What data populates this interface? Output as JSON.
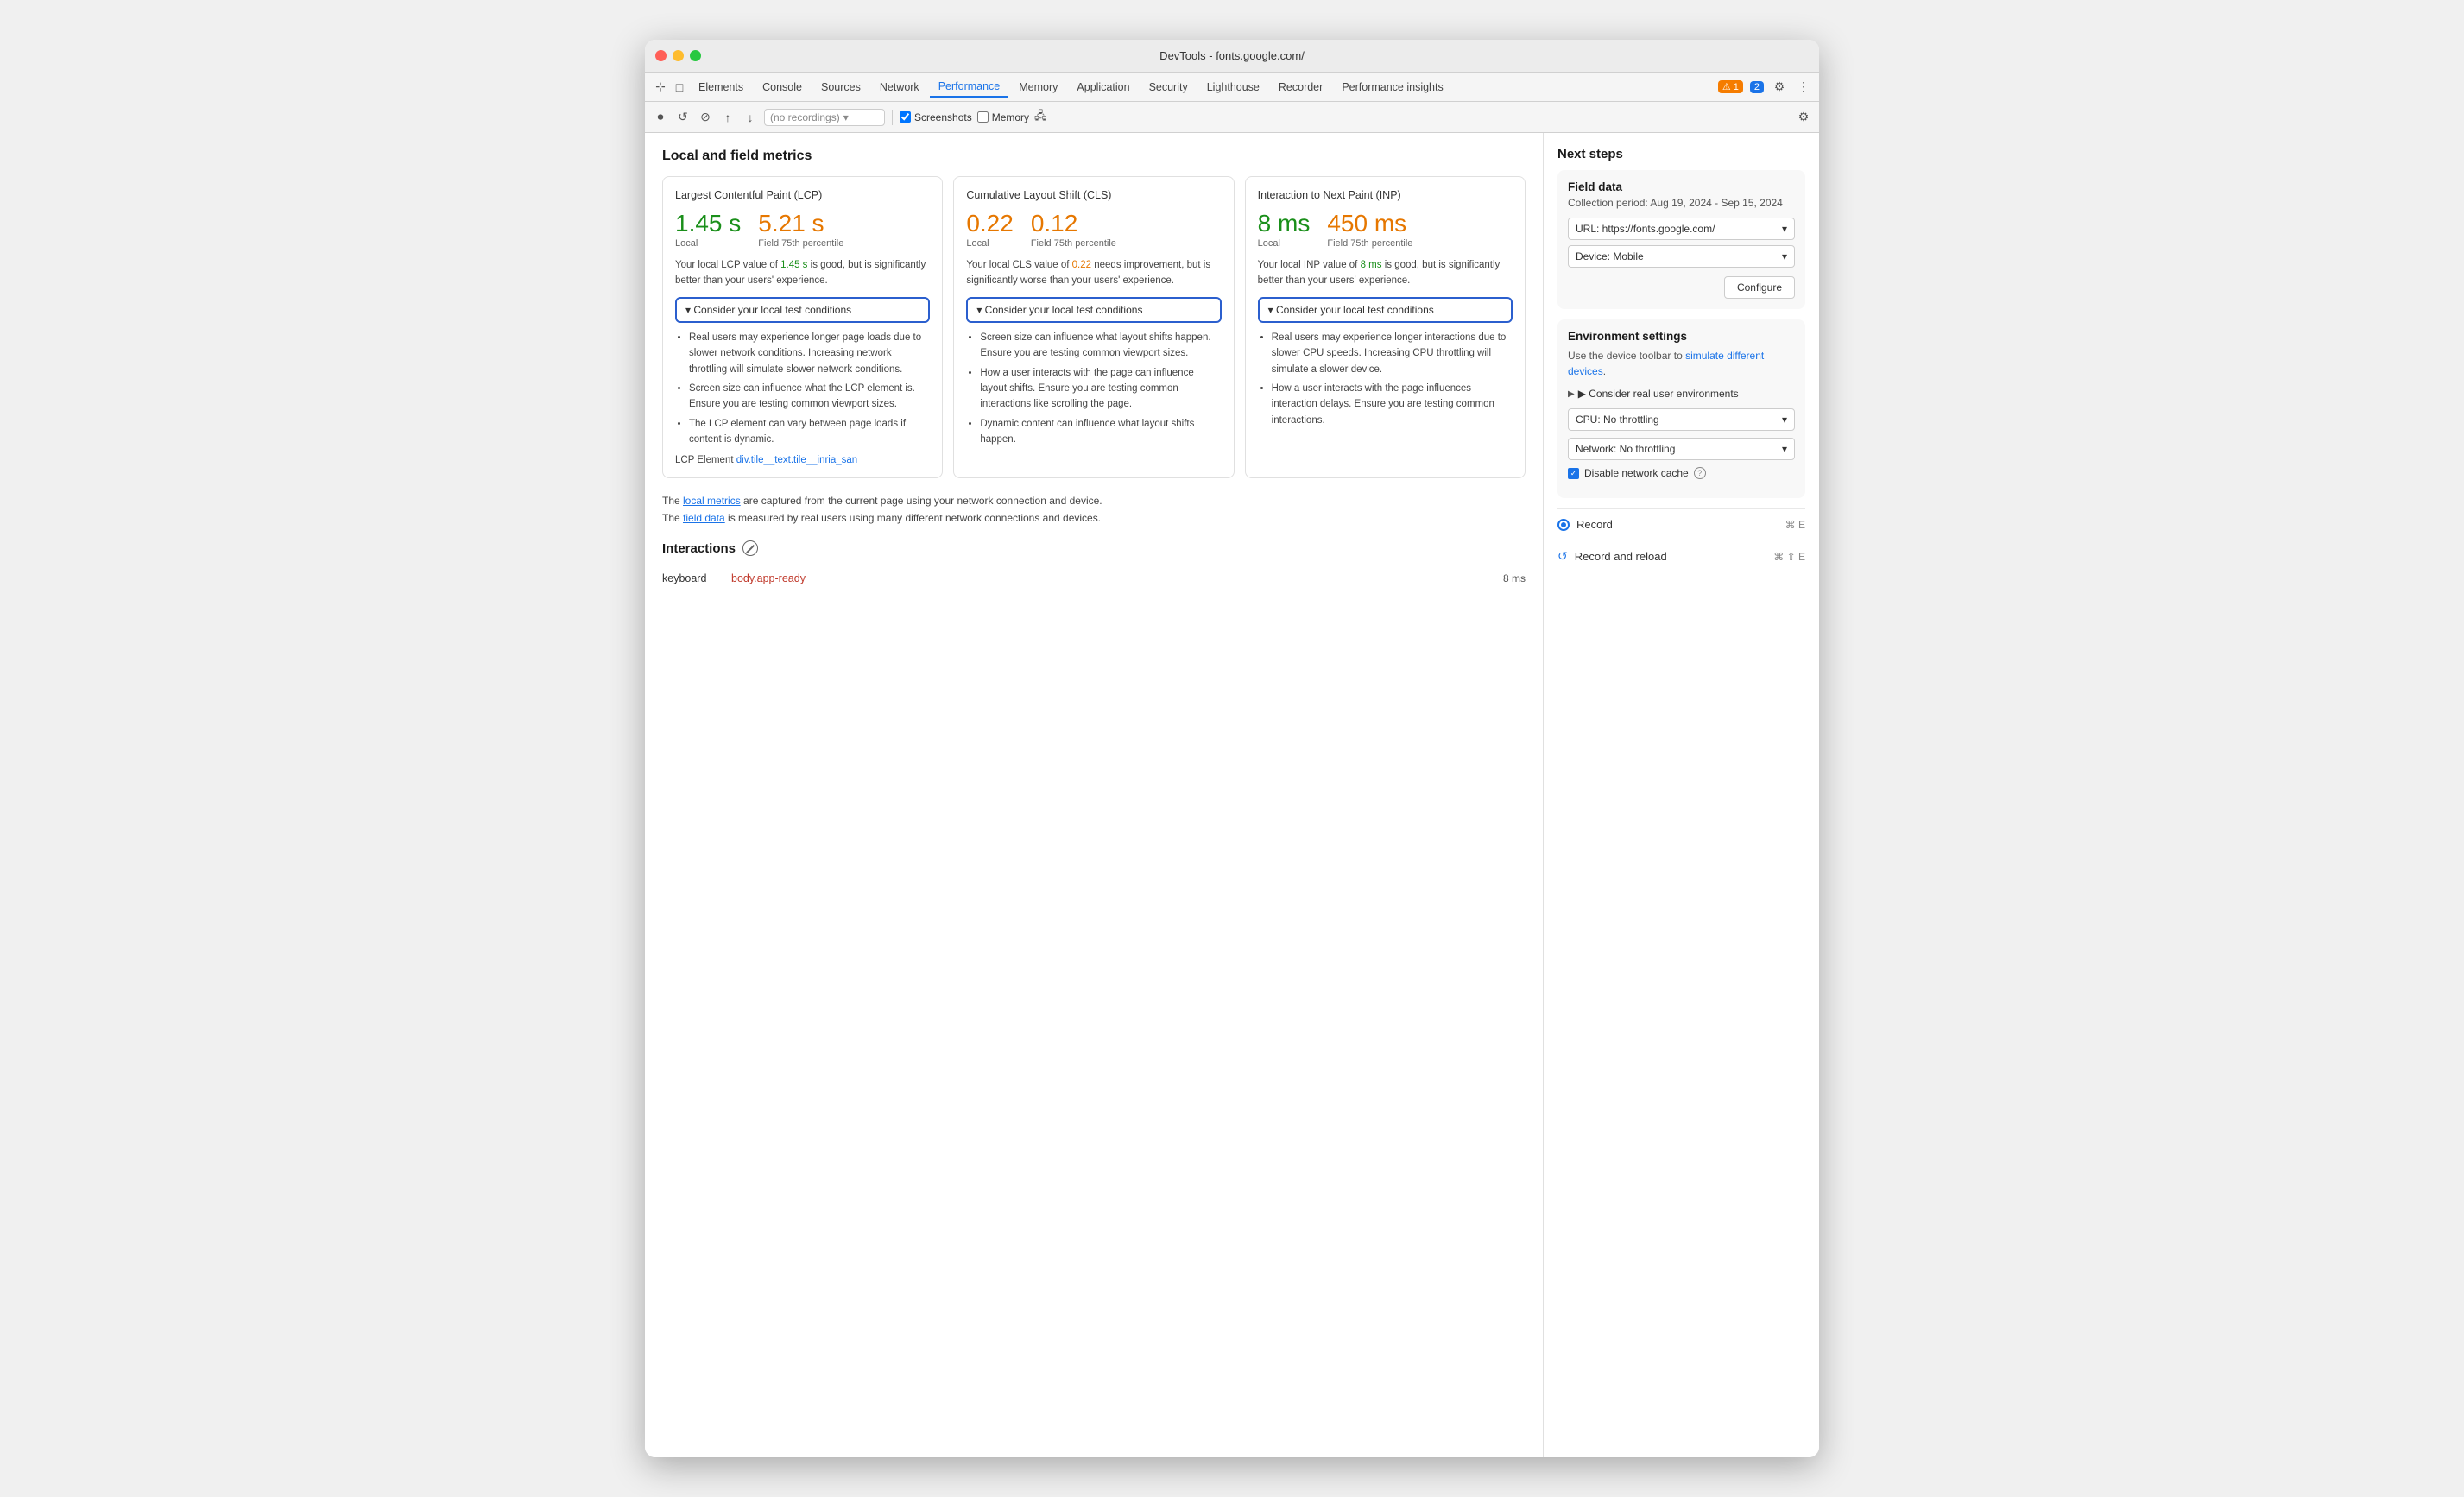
{
  "window": {
    "title": "DevTools - fonts.google.com/"
  },
  "traffic_lights": {
    "red": "red",
    "yellow": "yellow",
    "green": "green"
  },
  "tabs": {
    "items": [
      {
        "label": "Elements",
        "active": false
      },
      {
        "label": "Console",
        "active": false
      },
      {
        "label": "Sources",
        "active": false
      },
      {
        "label": "Network",
        "active": false
      },
      {
        "label": "Performance",
        "active": true
      },
      {
        "label": "Memory",
        "active": false
      },
      {
        "label": "Application",
        "active": false
      },
      {
        "label": "Security",
        "active": false
      },
      {
        "label": "Lighthouse",
        "active": false
      },
      {
        "label": "Recorder",
        "active": false
      },
      {
        "label": "Performance insights",
        "active": false
      }
    ],
    "warning_count": "1",
    "info_count": "2"
  },
  "toolbar": {
    "recordings_placeholder": "(no recordings)",
    "screenshots_label": "Screenshots",
    "memory_label": "Memory"
  },
  "metrics_section": {
    "title": "Local and field metrics",
    "cards": [
      {
        "title": "Largest Contentful Paint (LCP)",
        "local_value": "1.45 s",
        "local_label": "Local",
        "field_value": "5.21 s",
        "field_label": "Field 75th percentile",
        "local_color": "green",
        "field_color": "orange",
        "description_before": "Your local LCP value of ",
        "description_highlight": "1.45 s",
        "description_highlight_color": "green",
        "description_after": " is good, but is significantly better than your users' experience.",
        "consider_label": "▾ Consider your local test conditions",
        "bullets": [
          "Real users may experience longer page loads due to slower network conditions. Increasing network throttling will simulate slower network conditions.",
          "Screen size can influence what the LCP element is. Ensure you are testing common viewport sizes.",
          "The LCP element can vary between page loads if content is dynamic."
        ],
        "lcp_element_label": "LCP Element",
        "lcp_element_value": "div.tile__text.tile__inria_san"
      },
      {
        "title": "Cumulative Layout Shift (CLS)",
        "local_value": "0.22",
        "local_label": "Local",
        "field_value": "0.12",
        "field_label": "Field 75th percentile",
        "local_color": "orange",
        "field_color": "orange",
        "description_before": "Your local CLS value of ",
        "description_highlight": "0.22",
        "description_highlight_color": "orange",
        "description_after": " needs improvement, but is significantly worse than your users' experience.",
        "consider_label": "▾ Consider your local test conditions",
        "bullets": [
          "Screen size can influence what layout shifts happen. Ensure you are testing common viewport sizes.",
          "How a user interacts with the page can influence layout shifts. Ensure you are testing common interactions like scrolling the page.",
          "Dynamic content can influence what layout shifts happen."
        ],
        "lcp_element_label": null,
        "lcp_element_value": null
      },
      {
        "title": "Interaction to Next Paint (INP)",
        "local_value": "8 ms",
        "local_label": "Local",
        "field_value": "450 ms",
        "field_label": "Field 75th percentile",
        "local_color": "green",
        "field_color": "orange",
        "description_before": "Your local INP value of ",
        "description_highlight": "8 ms",
        "description_highlight_color": "green",
        "description_after": " is good, but is significantly better than your users' experience.",
        "consider_label": "▾ Consider your local test conditions",
        "bullets": [
          "Real users may experience longer interactions due to slower CPU speeds. Increasing CPU throttling will simulate a slower device.",
          "How a user interacts with the page influences interaction delays. Ensure you are testing common interactions."
        ],
        "lcp_element_label": null,
        "lcp_element_value": null
      }
    ],
    "footer_note_1": "The ",
    "footer_local_metrics": "local metrics",
    "footer_note_2": " are captured from the current page using your network connection and device.",
    "footer_note_3": "The ",
    "footer_field_data": "field data",
    "footer_note_4": " is measured by real users using many different network connections and devices."
  },
  "interactions": {
    "title": "Interactions",
    "rows": [
      {
        "name": "keyboard",
        "element": "body.app-ready",
        "time": "8 ms"
      }
    ]
  },
  "sidebar": {
    "title": "Next steps",
    "field_data": {
      "title": "Field data",
      "collection_period": "Collection period: Aug 19, 2024 - Sep 15, 2024",
      "url_label": "URL: https://fonts.google.com/",
      "device_label": "Device: Mobile",
      "configure_label": "Configure"
    },
    "environment": {
      "title": "Environment settings",
      "description": "Use the device toolbar to ",
      "description_link": "simulate different devices",
      "description_end": ".",
      "consider_label": "▶ Consider real user environments",
      "cpu_label": "CPU: No throttling",
      "network_label": "Network: No throttling",
      "disable_cache_label": "Disable network cache"
    },
    "record": {
      "label": "Record",
      "shortcut": "⌘ E"
    },
    "record_reload": {
      "label": "Record and reload",
      "shortcut": "⌘ ⇧ E"
    }
  }
}
